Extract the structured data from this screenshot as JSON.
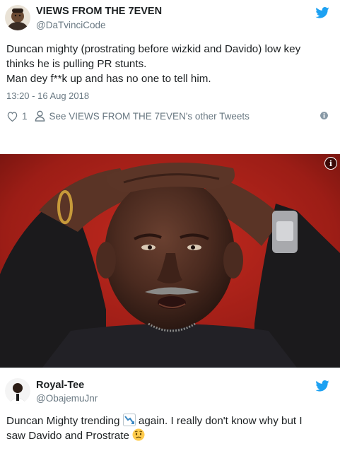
{
  "tweet1": {
    "display_name": "VIEWS FROM THE 7EVEN",
    "handle": "@DaTvinciCode",
    "text_line1": "Duncan mighty (prostrating before wizkid and Davido) low key",
    "text_line2": "thinks he is pulling PR stunts.",
    "text_line3": "Man dey f**k up and has no one to tell him.",
    "timestamp": "13:20 - 16 Aug 2018",
    "like_count": "1",
    "other_tweets_label": "See VIEWS FROM THE 7EVEN's other Tweets",
    "icons": [
      "twitter-bird-icon",
      "heart-icon",
      "person-icon",
      "info-icon"
    ]
  },
  "tweet2": {
    "display_name": "Royal-Tee",
    "handle": "@ObajemuJnr",
    "text_part1": "Duncan Mighty trending",
    "text_part2": " again.  I really don't know why but I",
    "text_line2": "saw Davido and Prostrate",
    "icons": [
      "twitter-bird-icon",
      "chart-decreasing-emoji",
      "worried-face-emoji"
    ]
  },
  "photo": {
    "alt": "",
    "icons": [
      "info-icon"
    ]
  },
  "colors": {
    "twitter_blue": "#1da1f2",
    "secondary_text": "#697882",
    "primary_text": "#1c2022",
    "divider": "#e6ecf0"
  }
}
